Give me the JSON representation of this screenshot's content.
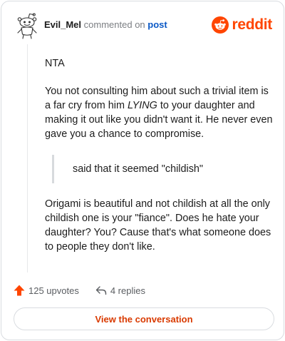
{
  "comment": {
    "username": "Evil_Mel",
    "commented_text": "commented on",
    "post_link": "post",
    "avatar_icon": "snoo-avatar-icon",
    "paragraphs": [
      "NTA",
      "You not consulting him about such a trivial item is a far cry from him ",
      " to your daughter and making it out like you didn't want it. He never even gave you a chance to compromise.",
      "Origami is beautiful and not childish at all the only childish one is your \"fiance\". Does he hate your daughter? You? Cause that's what someone does to people they don't like."
    ],
    "emphasis": "LYING",
    "quote": "said that it seemed \"childish\""
  },
  "brand": {
    "wordmark": "reddit",
    "icon": "reddit-logo-icon",
    "color": "#ff4500"
  },
  "actions": {
    "upvotes_label": "125 upvotes",
    "upvote_icon": "upvote-arrow-icon",
    "replies_label": "4 replies",
    "reply_icon": "reply-arrow-icon"
  },
  "cta": {
    "label": "View the conversation",
    "color": "#d93a00"
  },
  "colors": {
    "link": "#0a58c6",
    "muted": "#7c7f83",
    "border": "#d9dce0"
  }
}
